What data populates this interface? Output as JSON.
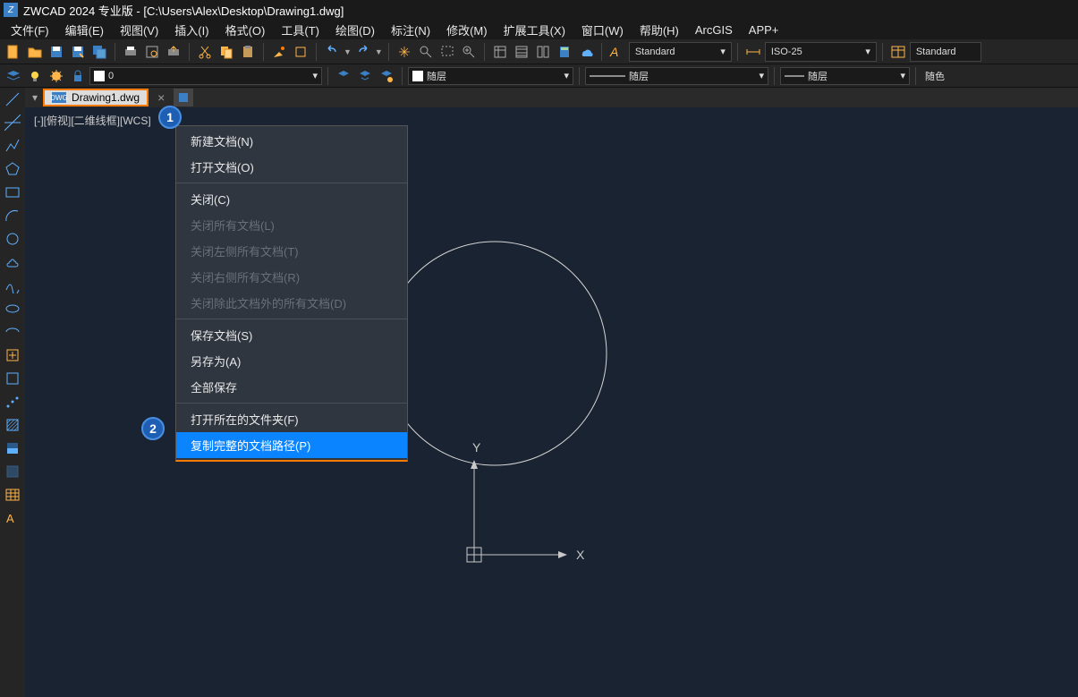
{
  "title": "ZWCAD 2024 专业版 - [C:\\Users\\Alex\\Desktop\\Drawing1.dwg]",
  "menus": [
    "文件(F)",
    "编辑(E)",
    "视图(V)",
    "插入(I)",
    "格式(O)",
    "工具(T)",
    "绘图(D)",
    "标注(N)",
    "修改(M)",
    "扩展工具(X)",
    "窗口(W)",
    "帮助(H)",
    "ArcGIS",
    "APP+"
  ],
  "styles": {
    "text": "Standard",
    "dim": "ISO-25",
    "table": "Standard"
  },
  "layerrow": {
    "name": "0"
  },
  "props": {
    "color": "随层",
    "linetype": "随层",
    "lineweight": "随层",
    "plotstyle": "随色"
  },
  "tab": {
    "name": "Drawing1.dwg",
    "icon": "DWG"
  },
  "viewlabel": "[-][俯视][二维线框][WCS]",
  "axis": {
    "x": "X",
    "y": "Y"
  },
  "ctx": {
    "new": "新建文档(N)",
    "open": "打开文档(O)",
    "close": "关闭(C)",
    "closeall": "关闭所有文档(L)",
    "closeleft": "关闭左侧所有文档(T)",
    "closeright": "关闭右侧所有文档(R)",
    "closeothers": "关闭除此文档外的所有文档(D)",
    "save": "保存文档(S)",
    "saveas": "另存为(A)",
    "saveall": "全部保存",
    "openfolder": "打开所在的文件夹(F)",
    "copypath": "复制完整的文档路径(P)"
  },
  "callouts": {
    "one": "1",
    "two": "2"
  }
}
